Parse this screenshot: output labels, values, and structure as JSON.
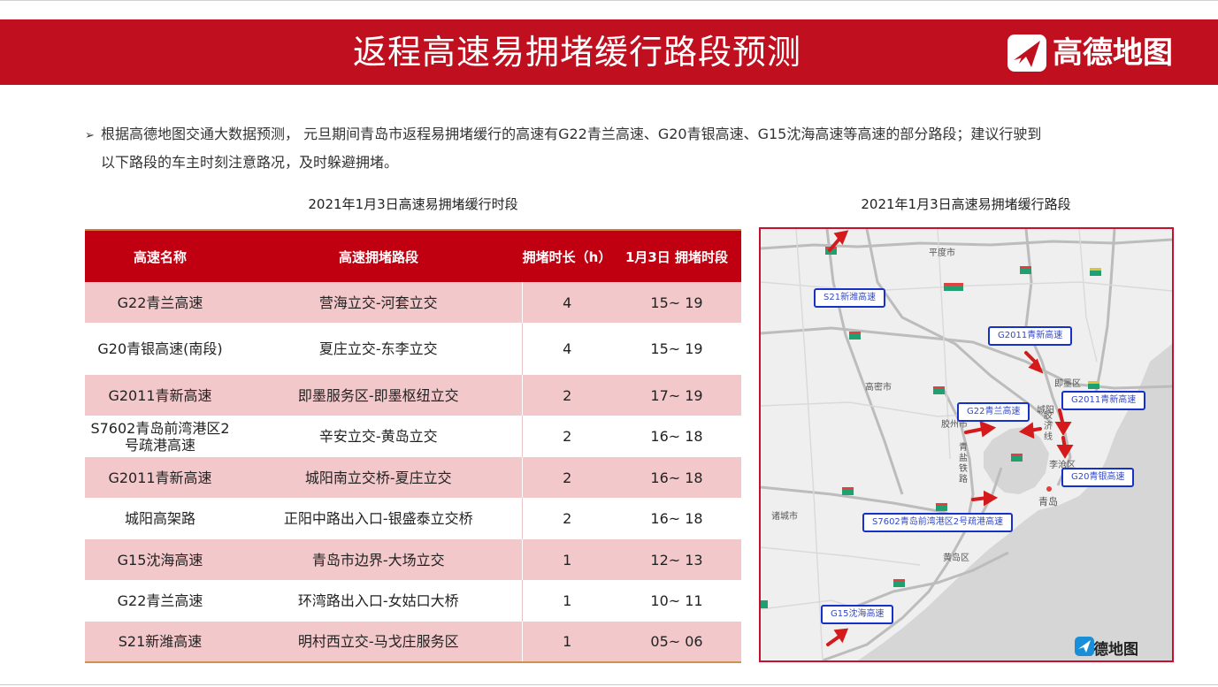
{
  "header": {
    "title": "返程高速易拥堵缓行路段预测",
    "brand": "高德地图"
  },
  "intro": {
    "line1": "根据高德地图交通大数据预测， 元旦期间青岛市返程易拥堵缓行的高速有G22青兰高速、G20青银高速、G15沈海高速等高速的部分路段；建议行驶到",
    "line2": "以下路段的车主时刻注意路况，及时躲避拥堵。"
  },
  "table": {
    "title": "2021年1月3日高速易拥堵缓行时段",
    "headers": [
      "高速名称",
      "高速拥堵路段",
      "拥堵时长（h）",
      "1月3日 拥堵时段"
    ],
    "rows": [
      {
        "name": "G22青兰高速",
        "section": "营海立交-河套立交",
        "hours": "4",
        "period": "15~ 19"
      },
      {
        "name": "G20青银高速(南段)",
        "section": "夏庄立交-东李立交",
        "hours": "4",
        "period": "15~ 19"
      },
      {
        "name": "G2011青新高速",
        "section": "即墨服务区-即墨枢纽立交",
        "hours": "2",
        "period": "17~ 19"
      },
      {
        "name": "S7602青岛前湾港区2号疏港高速",
        "section": "辛安立交-黄岛立交",
        "hours": "2",
        "period": "16~ 18"
      },
      {
        "name": "G2011青新高速",
        "section": "城阳南立交桥-夏庄立交",
        "hours": "2",
        "period": "16~ 18"
      },
      {
        "name": "城阳高架路",
        "section": "正阳中路出入口-银盛泰立交桥",
        "hours": "2",
        "period": "16~ 18"
      },
      {
        "name": "G15沈海高速",
        "section": "青岛市边界-大场立交",
        "hours": "1",
        "period": "12~ 13"
      },
      {
        "name": "G22青兰高速",
        "section": "环湾路出入口-女姑口大桥",
        "hours": "1",
        "period": "10~ 11"
      },
      {
        "name": "S21新潍高速",
        "section": "明村西立交-马戈庄服务区",
        "hours": "1",
        "period": "05~ 06"
      }
    ]
  },
  "map": {
    "title": "2021年1月3日高速易拥堵缓行路段",
    "labels": {
      "s21": "S21新潍高速",
      "g2011_north": "G2011青新高速",
      "g2011_east": "G2011青新高速",
      "g22": "G22青兰高速",
      "g20": "G20青银高速",
      "s7602": "S7602青岛前湾港区2号疏港高速",
      "g15": "G15沈海高速"
    },
    "places": {
      "pingdu": "平度市",
      "gaomi": "高密市",
      "jimo": "即墨区",
      "jiaozhou": "胶州市",
      "qingdao": "青岛",
      "huangdao": "黄岛区",
      "zhucheng": "诸城市",
      "licang": "李沧区",
      "chengyang": "城阳",
      "qingyan": "青\n盐\n铁\n路",
      "jiaoji": "胶\n济\n线"
    },
    "brand": "高德地图"
  },
  "colors": {
    "header_red": "#c0101f",
    "table_header_red": "#c00010",
    "row_pink": "#f2c8cb",
    "label_blue": "#1531c8",
    "jam_red": "#d41a1a",
    "sea": "#d6d6d6",
    "land": "#efefef",
    "logo_blue": "#1a8fd8"
  }
}
